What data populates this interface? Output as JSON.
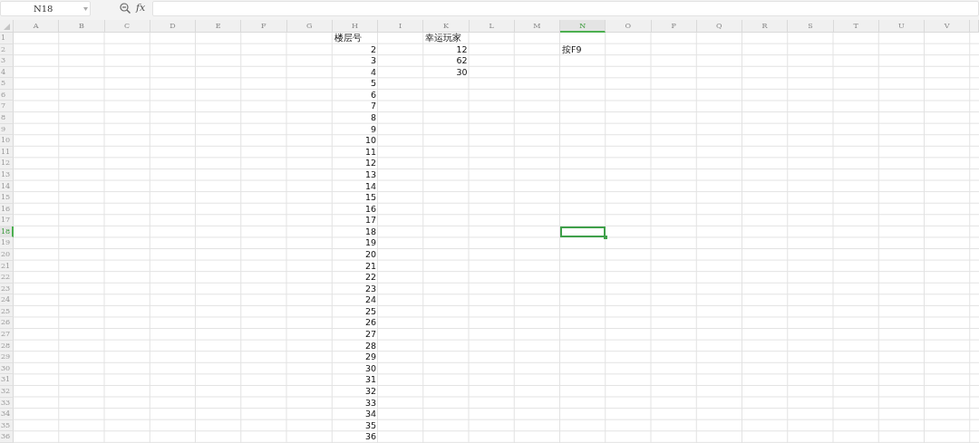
{
  "name_box": {
    "value": "N18"
  },
  "formula_bar": {
    "label": "fx"
  },
  "columns": [
    {
      "label": "A",
      "selected": false
    },
    {
      "label": "B",
      "selected": false
    },
    {
      "label": "C",
      "selected": false
    },
    {
      "label": "D",
      "selected": false
    },
    {
      "label": "E",
      "selected": false
    },
    {
      "label": "F",
      "selected": false
    },
    {
      "label": "G",
      "selected": false
    },
    {
      "label": "H",
      "selected": false
    },
    {
      "label": "I",
      "selected": false
    },
    {
      "label": "K",
      "selected": false
    },
    {
      "label": "L",
      "selected": false
    },
    {
      "label": "M",
      "selected": false
    },
    {
      "label": "N",
      "selected": true
    },
    {
      "label": "O",
      "selected": false
    },
    {
      "label": "P",
      "selected": false
    },
    {
      "label": "Q",
      "selected": false
    },
    {
      "label": "R",
      "selected": false
    },
    {
      "label": "S",
      "selected": false
    },
    {
      "label": "T",
      "selected": false
    },
    {
      "label": "U",
      "selected": false
    },
    {
      "label": "V",
      "selected": false
    }
  ],
  "rows": [
    {
      "number": "1",
      "selected": false,
      "cells": [
        null,
        null,
        null,
        null,
        null,
        null,
        null,
        {
          "text": "楼层号",
          "kind": "text"
        },
        null,
        {
          "text": "幸运玩家",
          "kind": "text"
        }
      ]
    },
    {
      "number": "2",
      "selected": false,
      "cells": [
        null,
        null,
        null,
        null,
        null,
        null,
        null,
        {
          "text": "2",
          "kind": "number"
        },
        null,
        {
          "text": "12",
          "kind": "number"
        },
        null,
        null,
        {
          "text": "按F9",
          "kind": "text"
        }
      ]
    },
    {
      "number": "3",
      "selected": false,
      "cells": [
        null,
        null,
        null,
        null,
        null,
        null,
        null,
        {
          "text": "3",
          "kind": "number"
        },
        null,
        {
          "text": "62",
          "kind": "number"
        }
      ]
    },
    {
      "number": "4",
      "selected": false,
      "cells": [
        null,
        null,
        null,
        null,
        null,
        null,
        null,
        {
          "text": "4",
          "kind": "number"
        },
        null,
        {
          "text": "30",
          "kind": "number"
        }
      ]
    },
    {
      "number": "5",
      "selected": false,
      "cells": [
        null,
        null,
        null,
        null,
        null,
        null,
        null,
        {
          "text": "5",
          "kind": "number"
        }
      ]
    },
    {
      "number": "6",
      "selected": false,
      "cells": [
        null,
        null,
        null,
        null,
        null,
        null,
        null,
        {
          "text": "6",
          "kind": "number"
        }
      ]
    },
    {
      "number": "7",
      "selected": false,
      "cells": [
        null,
        null,
        null,
        null,
        null,
        null,
        null,
        {
          "text": "7",
          "kind": "number"
        }
      ]
    },
    {
      "number": "8",
      "selected": false,
      "cells": [
        null,
        null,
        null,
        null,
        null,
        null,
        null,
        {
          "text": "8",
          "kind": "number"
        }
      ]
    },
    {
      "number": "9",
      "selected": false,
      "cells": [
        null,
        null,
        null,
        null,
        null,
        null,
        null,
        {
          "text": "9",
          "kind": "number"
        }
      ]
    },
    {
      "number": "10",
      "selected": false,
      "cells": [
        null,
        null,
        null,
        null,
        null,
        null,
        null,
        {
          "text": "10",
          "kind": "number"
        }
      ]
    },
    {
      "number": "11",
      "selected": false,
      "cells": [
        null,
        null,
        null,
        null,
        null,
        null,
        null,
        {
          "text": "11",
          "kind": "number"
        }
      ]
    },
    {
      "number": "12",
      "selected": false,
      "cells": [
        null,
        null,
        null,
        null,
        null,
        null,
        null,
        {
          "text": "12",
          "kind": "number"
        }
      ]
    },
    {
      "number": "13",
      "selected": false,
      "cells": [
        null,
        null,
        null,
        null,
        null,
        null,
        null,
        {
          "text": "13",
          "kind": "number"
        }
      ]
    },
    {
      "number": "14",
      "selected": false,
      "cells": [
        null,
        null,
        null,
        null,
        null,
        null,
        null,
        {
          "text": "14",
          "kind": "number"
        }
      ]
    },
    {
      "number": "15",
      "selected": false,
      "cells": [
        null,
        null,
        null,
        null,
        null,
        null,
        null,
        {
          "text": "15",
          "kind": "number"
        }
      ]
    },
    {
      "number": "16",
      "selected": false,
      "cells": [
        null,
        null,
        null,
        null,
        null,
        null,
        null,
        {
          "text": "16",
          "kind": "number"
        }
      ]
    },
    {
      "number": "17",
      "selected": false,
      "cells": [
        null,
        null,
        null,
        null,
        null,
        null,
        null,
        {
          "text": "17",
          "kind": "number"
        }
      ]
    },
    {
      "number": "18",
      "selected": true,
      "cells": [
        null,
        null,
        null,
        null,
        null,
        null,
        null,
        {
          "text": "18",
          "kind": "number"
        }
      ]
    },
    {
      "number": "19",
      "selected": false,
      "cells": [
        null,
        null,
        null,
        null,
        null,
        null,
        null,
        {
          "text": "19",
          "kind": "number"
        }
      ]
    },
    {
      "number": "20",
      "selected": false,
      "cells": [
        null,
        null,
        null,
        null,
        null,
        null,
        null,
        {
          "text": "20",
          "kind": "number"
        }
      ]
    },
    {
      "number": "21",
      "selected": false,
      "cells": [
        null,
        null,
        null,
        null,
        null,
        null,
        null,
        {
          "text": "21",
          "kind": "number"
        }
      ]
    },
    {
      "number": "22",
      "selected": false,
      "cells": [
        null,
        null,
        null,
        null,
        null,
        null,
        null,
        {
          "text": "22",
          "kind": "number"
        }
      ]
    },
    {
      "number": "23",
      "selected": false,
      "cells": [
        null,
        null,
        null,
        null,
        null,
        null,
        null,
        {
          "text": "23",
          "kind": "number"
        }
      ]
    },
    {
      "number": "24",
      "selected": false,
      "cells": [
        null,
        null,
        null,
        null,
        null,
        null,
        null,
        {
          "text": "24",
          "kind": "number"
        }
      ]
    },
    {
      "number": "25",
      "selected": false,
      "cells": [
        null,
        null,
        null,
        null,
        null,
        null,
        null,
        {
          "text": "25",
          "kind": "number"
        }
      ]
    },
    {
      "number": "26",
      "selected": false,
      "cells": [
        null,
        null,
        null,
        null,
        null,
        null,
        null,
        {
          "text": "26",
          "kind": "number"
        }
      ]
    },
    {
      "number": "27",
      "selected": false,
      "cells": [
        null,
        null,
        null,
        null,
        null,
        null,
        null,
        {
          "text": "27",
          "kind": "number"
        }
      ]
    },
    {
      "number": "28",
      "selected": false,
      "cells": [
        null,
        null,
        null,
        null,
        null,
        null,
        null,
        {
          "text": "28",
          "kind": "number"
        }
      ]
    },
    {
      "number": "29",
      "selected": false,
      "cells": [
        null,
        null,
        null,
        null,
        null,
        null,
        null,
        {
          "text": "29",
          "kind": "number"
        }
      ]
    },
    {
      "number": "30",
      "selected": false,
      "cells": [
        null,
        null,
        null,
        null,
        null,
        null,
        null,
        {
          "text": "30",
          "kind": "number"
        }
      ]
    },
    {
      "number": "31",
      "selected": false,
      "cells": [
        null,
        null,
        null,
        null,
        null,
        null,
        null,
        {
          "text": "31",
          "kind": "number"
        }
      ]
    },
    {
      "number": "32",
      "selected": false,
      "cells": [
        null,
        null,
        null,
        null,
        null,
        null,
        null,
        {
          "text": "32",
          "kind": "number"
        }
      ]
    },
    {
      "number": "33",
      "selected": false,
      "cells": [
        null,
        null,
        null,
        null,
        null,
        null,
        null,
        {
          "text": "33",
          "kind": "number"
        }
      ]
    },
    {
      "number": "34",
      "selected": false,
      "cells": [
        null,
        null,
        null,
        null,
        null,
        null,
        null,
        {
          "text": "34",
          "kind": "number"
        }
      ]
    },
    {
      "number": "35",
      "selected": false,
      "cells": [
        null,
        null,
        null,
        null,
        null,
        null,
        null,
        {
          "text": "35",
          "kind": "number"
        }
      ]
    },
    {
      "number": "36",
      "selected": false,
      "cells": [
        null,
        null,
        null,
        null,
        null,
        null,
        null,
        {
          "text": "36",
          "kind": "number"
        }
      ]
    }
  ]
}
